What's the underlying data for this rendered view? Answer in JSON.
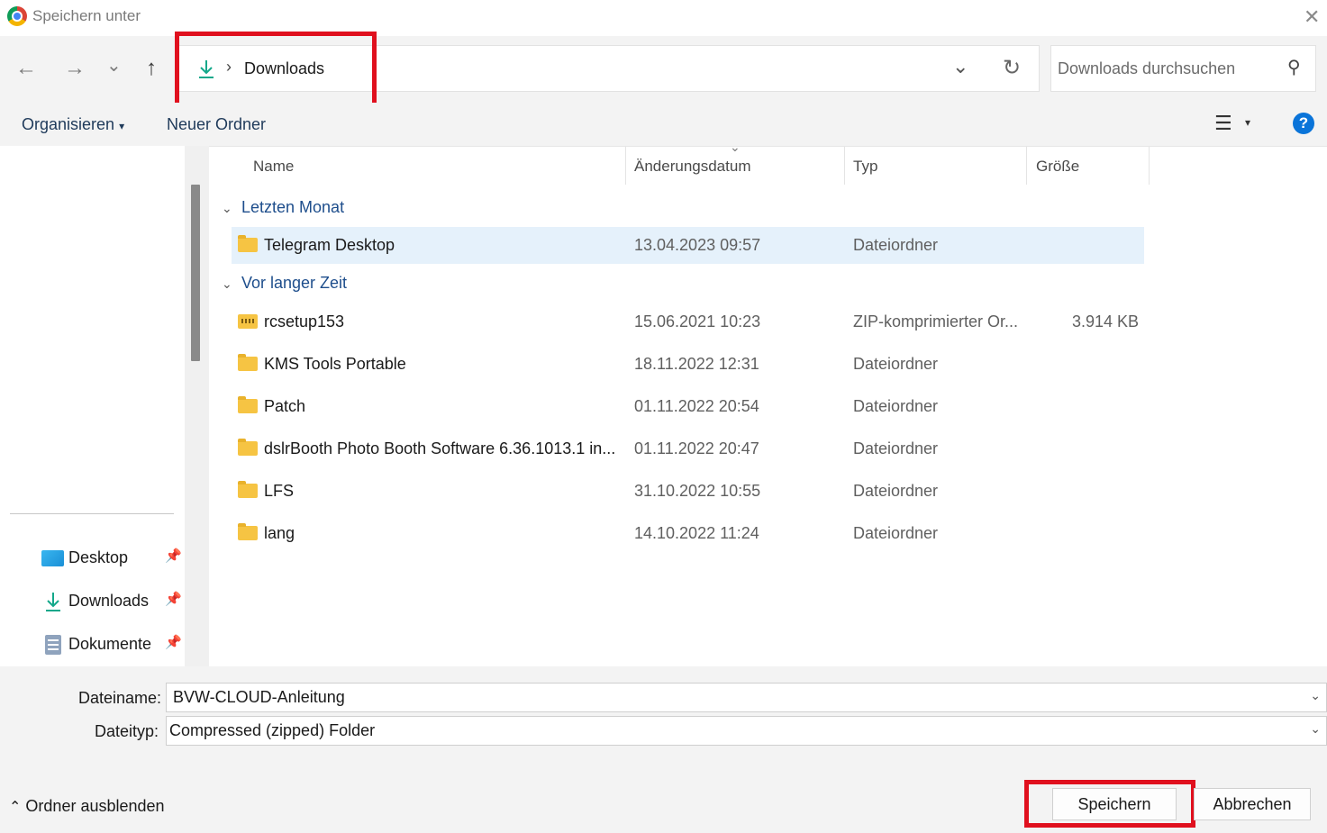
{
  "window": {
    "title": "Speichern unter",
    "close_glyph": "✕"
  },
  "nav": {
    "back_glyph": "←",
    "forward_glyph": "→",
    "recent_glyph": "⌄",
    "up_glyph": "↑",
    "breadcrumb_separator": "›",
    "breadcrumb_location": "Downloads",
    "address_dropdown_glyph": "⌄",
    "refresh_glyph": "↻",
    "search_placeholder": "Downloads durchsuchen",
    "search_glyph": "⚲"
  },
  "toolbar": {
    "organize": "Organisieren",
    "organize_caret": "▾",
    "new_folder": "Neuer Ordner",
    "view_glyph": "☰",
    "view_caret": "▾",
    "help_glyph": "?"
  },
  "columns": {
    "name": "Name",
    "date": "Änderungsdatum",
    "type": "Typ",
    "size": "Größe",
    "sort_glyph": "⌄"
  },
  "groups": [
    {
      "label": "Letzten Monat",
      "items": [
        {
          "name": "Telegram Desktop",
          "date": "13.04.2023 09:57",
          "type": "Dateiordner",
          "size": "",
          "icon": "folder-icon",
          "selected": true
        }
      ]
    },
    {
      "label": "Vor langer Zeit",
      "items": [
        {
          "name": "rcsetup153",
          "date": "15.06.2021 10:23",
          "type": "ZIP-komprimierter Or...",
          "size": "3.914 KB",
          "icon": "zip-folder-icon"
        },
        {
          "name": "KMS Tools Portable",
          "date": "18.11.2022 12:31",
          "type": "Dateiordner",
          "size": "",
          "icon": "folder-icon"
        },
        {
          "name": "Patch",
          "date": "01.11.2022 20:54",
          "type": "Dateiordner",
          "size": "",
          "icon": "folder-icon"
        },
        {
          "name": "dslrBooth Photo Booth Software 6.36.1013.1 in...",
          "date": "01.11.2022 20:47",
          "type": "Dateiordner",
          "size": "",
          "icon": "folder-icon"
        },
        {
          "name": "LFS",
          "date": "31.10.2022 10:55",
          "type": "Dateiordner",
          "size": "",
          "icon": "folder-icon"
        },
        {
          "name": "lang",
          "date": "14.10.2022 11:24",
          "type": "Dateiordner",
          "size": "",
          "icon": "folder-icon"
        }
      ]
    }
  ],
  "group_chevron": "⌄",
  "quick_access": [
    {
      "label": "Desktop",
      "icon": "desktop-icon"
    },
    {
      "label": "Downloads",
      "icon": "download-icon"
    },
    {
      "label": "Dokumente",
      "icon": "documents-icon"
    }
  ],
  "pin_glyph": "📌",
  "form": {
    "filename_label": "Dateiname:",
    "filename_value": "BVW-CLOUD-Anleitung",
    "filetype_label": "Dateityp:",
    "filetype_value": "Compressed (zipped) Folder",
    "dropdown_glyph": "⌄"
  },
  "footer": {
    "hide_folders_glyph": "⌃",
    "hide_folders": "Ordner ausblenden",
    "save": "Speichern",
    "cancel": "Abbrechen"
  },
  "colors": {
    "accent": "#0a74d9",
    "highlight_box": "#e0101e",
    "selection": "#e5f1fb",
    "group_header": "#1e4e8c"
  }
}
